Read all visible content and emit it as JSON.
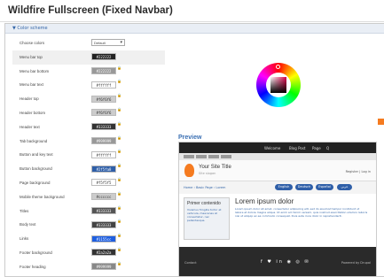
{
  "page": {
    "title": "Wildfire Fullscreen (Fixed Navbar)"
  },
  "panel": {
    "header": "▼ Color scheme"
  },
  "form": {
    "choose_colors_label": "Choose colors",
    "choose_colors_value": "Default",
    "rows": [
      {
        "label": "Menu bar top",
        "value": "#222222",
        "bg": "#222222",
        "fg": "#ffffff"
      },
      {
        "label": "Menu bar bottom",
        "value": "#222222",
        "bg": "#999999",
        "fg": "#ffffff"
      },
      {
        "label": "Menu bar text",
        "value": "#ffffff",
        "bg": "#ffffff",
        "fg": "#333333"
      },
      {
        "label": "Header top",
        "value": "#f6f6f6",
        "bg": "#cccccc",
        "fg": "#333333"
      },
      {
        "label": "Header bottom",
        "value": "#f6f6f6",
        "bg": "#cccccc",
        "fg": "#333333"
      },
      {
        "label": "Header text",
        "value": "#333333",
        "bg": "#333333",
        "fg": "#ffffff"
      },
      {
        "label": "Tab background",
        "value": "#999999",
        "bg": "#999999",
        "fg": "#ffffff"
      },
      {
        "label": "Button and key text",
        "value": "#ffffff",
        "bg": "#ffffff",
        "fg": "#333333"
      },
      {
        "label": "Button background",
        "value": "#2f5fa8",
        "bg": "#2f5fa8",
        "fg": "#ffffff"
      },
      {
        "label": "Page background",
        "value": "#f5f5f5",
        "bg": "#ffffff",
        "fg": "#333333"
      },
      {
        "label": "Mobile theme background",
        "value": "#cccccc",
        "bg": "#cccccc",
        "fg": "#333333"
      },
      {
        "label": "Titles",
        "value": "#333333",
        "bg": "#555555",
        "fg": "#ffffff"
      },
      {
        "label": "Body text",
        "value": "#333333",
        "bg": "#444444",
        "fg": "#ffffff"
      },
      {
        "label": "Links",
        "value": "#1155cc",
        "bg": "#1f5fe0",
        "fg": "#ffffff"
      },
      {
        "label": "Footer background",
        "value": "#2a2a2a",
        "bg": "#333333",
        "fg": "#ffffff"
      },
      {
        "label": "Footer heading",
        "value": "#999999",
        "bg": "#888888",
        "fg": "#ffffff"
      }
    ]
  },
  "preview": {
    "title": "Preview",
    "nav": [
      "Welcome",
      "Blog Post",
      "Page",
      "Q"
    ],
    "site_name": "Your Site Title",
    "tagline": "Site slogan",
    "login": "Register | Log in",
    "crumbs": "Home › Basic Page › Lorem",
    "pills": [
      "English",
      "Deutsch",
      "Español",
      "عربي"
    ],
    "box_title": "Primer contenido",
    "box_text": "Vivamus fringilla tortor et vehicula, maecenas at consectetur, nec pellentesque.",
    "heading": "Lorem ipsum dolor",
    "body": "Lorem ipsum dolor sit amet, consectetur adipiscing elit, sed do eiusmod tempor incididunt ut labore et dolore magna aliqua. Ut enim ad minim veniam, quis nostrud exercitation ullamco laboris nisi ut aliquip ex ea commodo consequat. Duis aute irure dolor in reprehenderit.",
    "footer_left": "Contact",
    "footer_icons": "f ♥ in ◉ ◎ ✉",
    "footer_right": "Powered by Drupal"
  }
}
